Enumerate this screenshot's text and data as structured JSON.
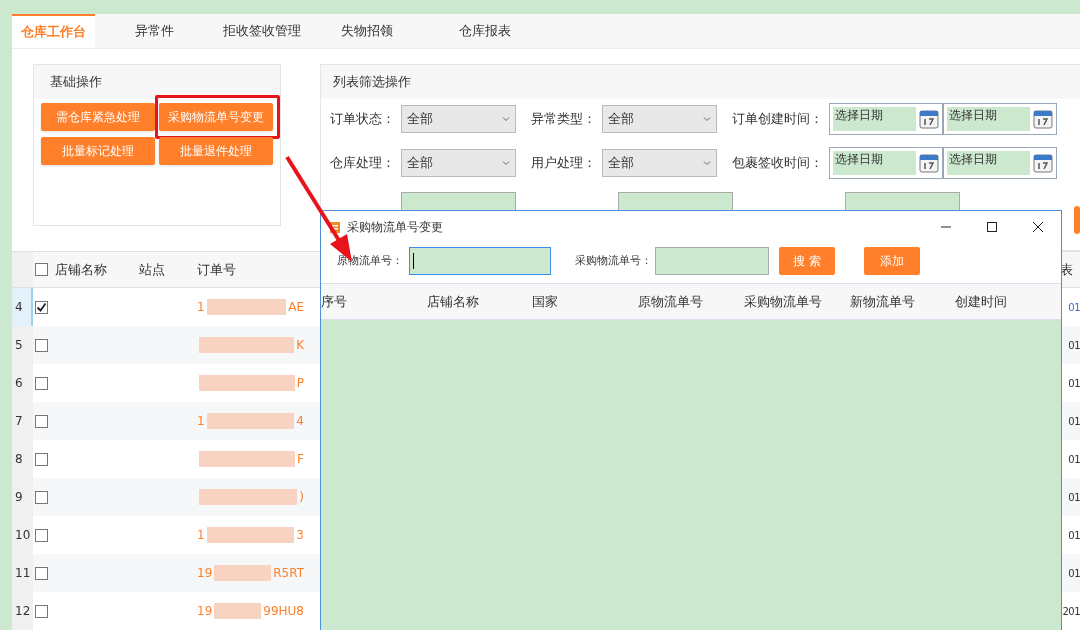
{
  "tabs": [
    {
      "label": "仓库工作台",
      "selected": true
    },
    {
      "label": "异常件",
      "selected": false
    },
    {
      "label": "拒收签收管理",
      "selected": false
    },
    {
      "label": "失物招领",
      "selected": false
    },
    {
      "label": "仓库报表",
      "selected": false
    }
  ],
  "basic_ops": {
    "title": "基础操作",
    "buttons": [
      {
        "label": "需仓库紧急处理",
        "highlighted": false
      },
      {
        "label": "采购物流单号变更",
        "highlighted": true
      },
      {
        "label": "批量标记处理",
        "highlighted": false
      },
      {
        "label": "批量退件处理",
        "highlighted": false
      }
    ]
  },
  "filters": {
    "title": "列表筛选操作",
    "rows": [
      {
        "fields": [
          {
            "kind": "select",
            "label": "订单状态：",
            "value": "全部"
          },
          {
            "kind": "select",
            "label": "异常类型：",
            "value": "全部"
          },
          {
            "kind": "date_range",
            "label": "订单创建时间：",
            "placeholders": [
              "选择日期",
              "选择日期"
            ]
          }
        ]
      },
      {
        "fields": [
          {
            "kind": "select",
            "label": "仓库处理：",
            "value": "全部"
          },
          {
            "kind": "select",
            "label": "用户处理：",
            "value": "全部"
          },
          {
            "kind": "date_range",
            "label": "包裹签收时间：",
            "placeholders": [
              "选择日期",
              "选择日期"
            ]
          }
        ]
      }
    ]
  },
  "table": {
    "header_checkbox": {
      "checked": false
    },
    "columns": [
      "店铺名称",
      "站点",
      "订单号"
    ],
    "last_column": "表",
    "rows": [
      {
        "number": "4",
        "checked": true,
        "selected": true,
        "order_start": "1",
        "order_end": "AE",
        "last_cell": "01"
      },
      {
        "number": "5",
        "checked": false,
        "selected": false,
        "order_start": "",
        "order_end": "K",
        "last_cell": "01"
      },
      {
        "number": "6",
        "checked": false,
        "selected": false,
        "order_start": "",
        "order_end": "P",
        "last_cell": "01"
      },
      {
        "number": "7",
        "checked": false,
        "selected": false,
        "order_start": "1",
        "order_end": "4",
        "last_cell": "01"
      },
      {
        "number": "8",
        "checked": false,
        "selected": false,
        "order_start": "",
        "order_end": "F",
        "last_cell": "01"
      },
      {
        "number": "9",
        "checked": false,
        "selected": false,
        "order_start": "",
        "order_end": ")",
        "last_cell": "01"
      },
      {
        "number": "10",
        "checked": false,
        "selected": false,
        "order_start": "1",
        "order_end": "3",
        "last_cell": "01"
      },
      {
        "number": "11",
        "checked": false,
        "selected": false,
        "order_start": "19",
        "order_end": "R5RT",
        "last_cell": "01"
      },
      {
        "number": "12",
        "checked": false,
        "selected": false,
        "order_start": "19",
        "order_end": "99HU8",
        "last_cell": "201"
      }
    ]
  },
  "dialog": {
    "title": "采购物流单号变更",
    "fields": [
      {
        "label": "原物流单号：",
        "focused": true
      },
      {
        "label": "采购物流单号：",
        "focused": false
      }
    ],
    "buttons": [
      "搜 索",
      "添加"
    ],
    "columns": [
      "序号",
      "店铺名称",
      "国家",
      "原物流单号",
      "采购物流单号",
      "新物流单号",
      "创建时间"
    ]
  }
}
